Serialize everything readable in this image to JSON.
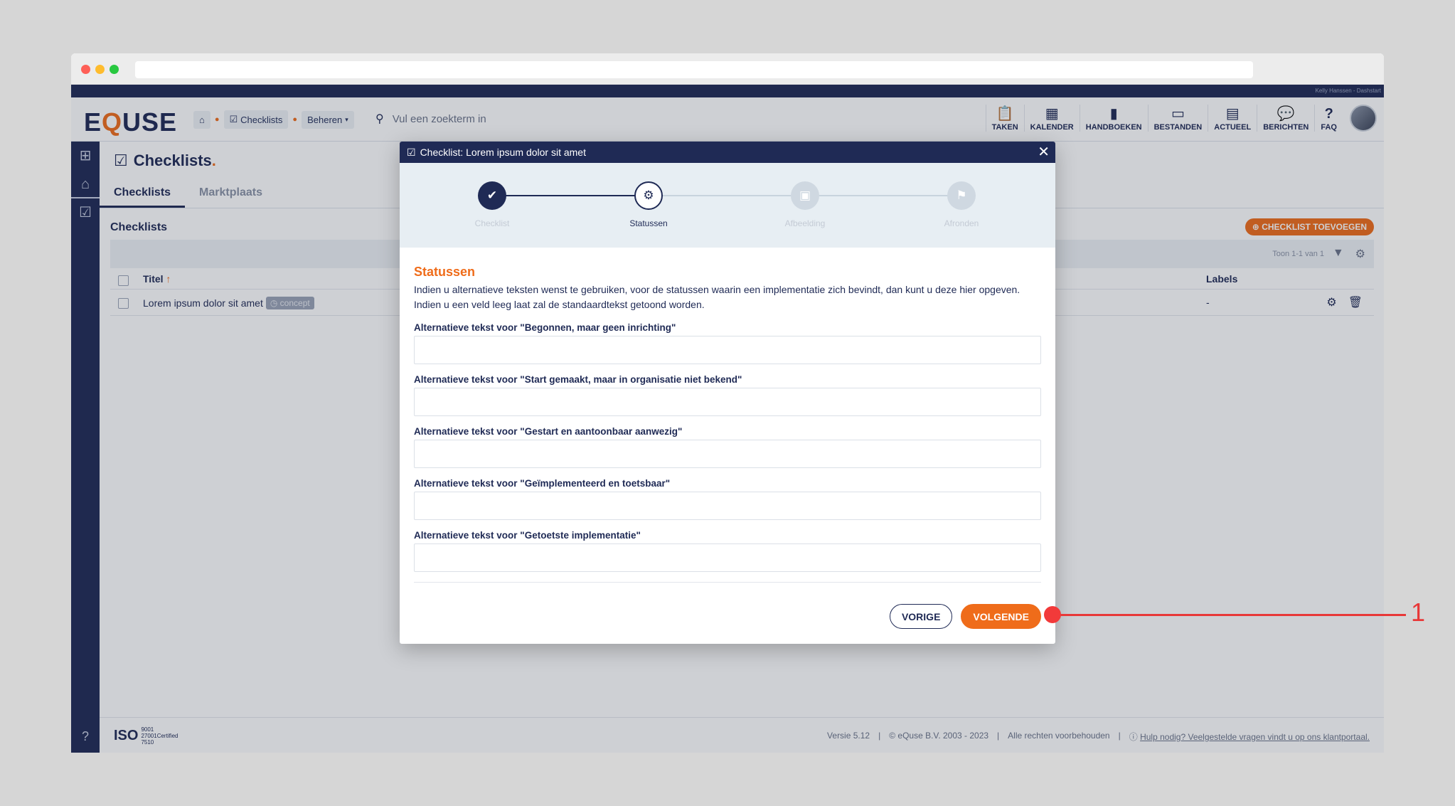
{
  "top_strip": "Kelly Hanssen - Dashstart",
  "header": {
    "logo_pre": "E",
    "logo_q": "Q",
    "logo_post": "USE",
    "crumb_checklists": "Checklists",
    "crumb_beheren": "Beheren",
    "search_placeholder": "Vul een zoekterm in",
    "nav": {
      "taken": "TAKEN",
      "kalender": "KALENDER",
      "handboeken": "HANDBOEKEN",
      "bestanden": "BESTANDEN",
      "actueel": "ACTUEEL",
      "berichten": "BERICHTEN",
      "faq": "FAQ"
    }
  },
  "page": {
    "title": "Checklists",
    "title_dot": ".",
    "tabs": {
      "checklists": "Checklists",
      "marktplaats": "Marktplaats"
    },
    "section_title": "Checklists",
    "add_button": "CHECKLIST TOEVOEGEN",
    "grid_info": "Toon 1-1 van 1",
    "columns": {
      "titel": "Titel",
      "labels": "Labels"
    },
    "rows": [
      {
        "title": "Lorem ipsum dolor sit amet",
        "badge": "concept",
        "labels": "-"
      }
    ]
  },
  "footer": {
    "iso_big": "ISO",
    "iso_line1": "9001",
    "iso_line2": "27001Certified",
    "iso_line3": "7510",
    "version": "Versie 5.12",
    "copyright": "© eQuse B.V. 2003 - 2023",
    "rights": "Alle rechten voorbehouden",
    "help": "Hulp nodig? Veelgestelde vragen vindt u op ons klantportaal."
  },
  "modal": {
    "title": "Checklist: Lorem ipsum dolor sit amet",
    "steps": {
      "s1": "Checklist",
      "s2": "Statussen",
      "s3": "Afbeelding",
      "s4": "Afronden"
    },
    "section_title": "Statussen",
    "intro_line1": "Indien u alternatieve teksten wenst te gebruiken, voor de statussen waarin een implementatie zich bevindt, dan kunt u deze hier opgeven.",
    "intro_line2": "Indien u een veld leeg laat zal de standaardtekst getoond worden.",
    "fields": {
      "f1": {
        "label": "Alternatieve tekst voor \"Begonnen, maar geen inrichting\"",
        "value": ""
      },
      "f2": {
        "label": "Alternatieve tekst voor \"Start gemaakt, maar in organisatie niet bekend\"",
        "value": ""
      },
      "f3": {
        "label": "Alternatieve tekst voor \"Gestart en aantoonbaar aanwezig\"",
        "value": ""
      },
      "f4": {
        "label": "Alternatieve tekst voor \"Geïmplementeerd en toetsbaar\"",
        "value": ""
      },
      "f5": {
        "label": "Alternatieve tekst voor \"Getoetste implementatie\"",
        "value": ""
      }
    },
    "prev_button": "VORIGE",
    "next_button": "VOLGENDE"
  },
  "annotation": {
    "number": "1"
  },
  "colors": {
    "navy": "#1f2a55",
    "accent_orange": "#ef6c1a",
    "annotation_red": "#e83838"
  }
}
